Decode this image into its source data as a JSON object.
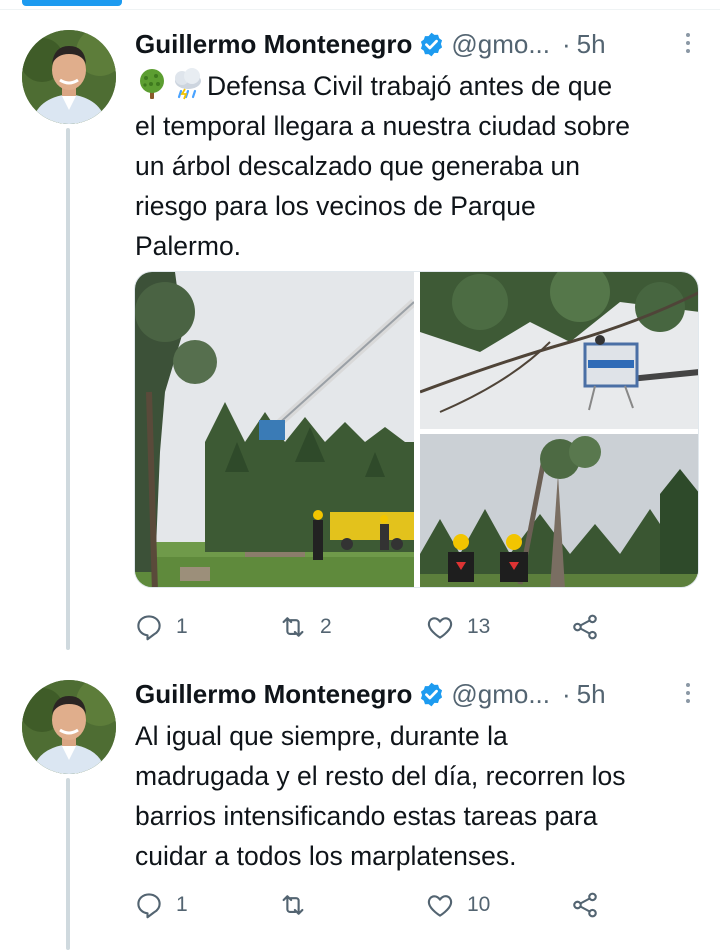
{
  "tweets": [
    {
      "author_name": "Guillermo Montenegro",
      "handle": "@gmo...",
      "separator": "·",
      "time": "5h",
      "emojis": [
        "tree-emoji",
        "cloud-with-rain-emoji"
      ],
      "text_lines": [
        "Defensa Civil trabajó antes de que",
        "el temporal llegara a nuestra ciudad sobre",
        "un árbol descalzado que generaba un",
        "riesgo para los vecinos de Parque",
        "Palermo."
      ],
      "photos": [
        "crane-lift-tree-photo",
        "crane-basket-branches-photo",
        "workers-tree-photo"
      ],
      "replies": "1",
      "retweets": "2",
      "likes": "13"
    },
    {
      "author_name": "Guillermo Montenegro",
      "handle": "@gmo...",
      "separator": "·",
      "time": "5h",
      "text_lines": [
        "Al igual que siempre, durante la",
        "madrugada y el resto del día, recorren los",
        "barrios intensificando estas tareas para",
        "cuidar a todos los marplatenses."
      ],
      "replies": "1",
      "retweets": "",
      "likes": "10"
    }
  ],
  "colors": {
    "accent": "#1d9bf0",
    "text": "#0f1419",
    "secondary": "#536471",
    "thread_line": "#cfd9de"
  },
  "icons": [
    "reply-icon",
    "retweet-icon",
    "like-icon",
    "share-icon",
    "verified-badge-icon",
    "more-options-icon"
  ]
}
